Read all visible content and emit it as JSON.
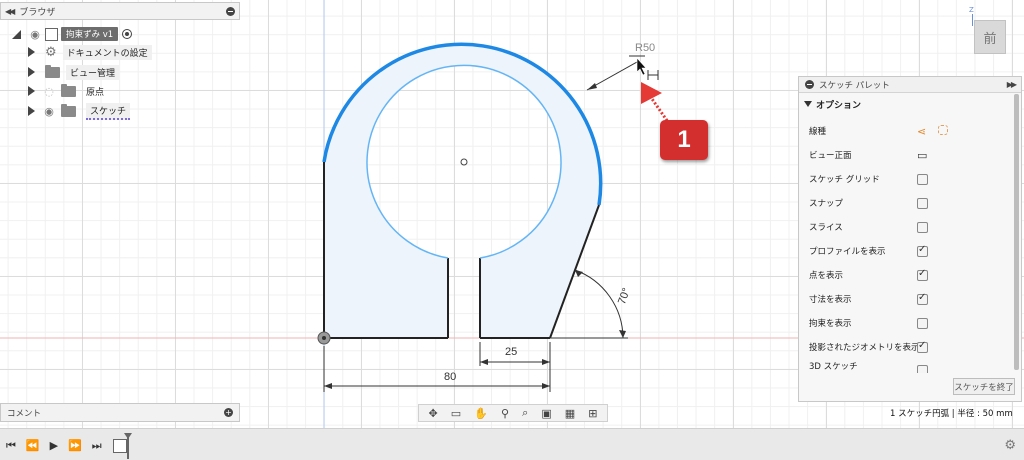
{
  "browser": {
    "title": "ブラウザ",
    "component": "拘束ずみ v1",
    "items": [
      {
        "label": "ドキュメントの設定"
      },
      {
        "label": "ビュー管理"
      },
      {
        "label": "原点"
      },
      {
        "label": "スケッチ"
      }
    ]
  },
  "viewcube": {
    "face": "前",
    "axis": "Z"
  },
  "dimensions": {
    "radius": "R50",
    "slot_width": "25",
    "total_width": "80",
    "angle": "70°"
  },
  "callout": {
    "number": "1",
    "color": "#d32f2f"
  },
  "palette": {
    "title": "スケッチ パレット",
    "section": "オプション",
    "options": [
      {
        "label": "線種",
        "control": "icons"
      },
      {
        "label": "ビュー正面",
        "control": "icon"
      },
      {
        "label": "スケッチ グリッド",
        "checked": false
      },
      {
        "label": "スナップ",
        "checked": false
      },
      {
        "label": "スライス",
        "checked": false
      },
      {
        "label": "プロファイルを表示",
        "checked": true
      },
      {
        "label": "点を表示",
        "checked": true
      },
      {
        "label": "寸法を表示",
        "checked": true
      },
      {
        "label": "拘束を表示",
        "checked": false
      },
      {
        "label": "投影されたジオメトリを表示",
        "checked": true
      },
      {
        "label": "3D スケッチ",
        "checked": false
      }
    ],
    "finish_label": "スケッチを終了"
  },
  "comment": {
    "label": "コメント"
  },
  "status": {
    "text": "1 スケッチ円弧 | 半径 : 50 mm"
  },
  "colors": {
    "accent": "#1e88e5",
    "profile_fill": "#eef4fb",
    "inner_circle": "#64b5f6"
  }
}
